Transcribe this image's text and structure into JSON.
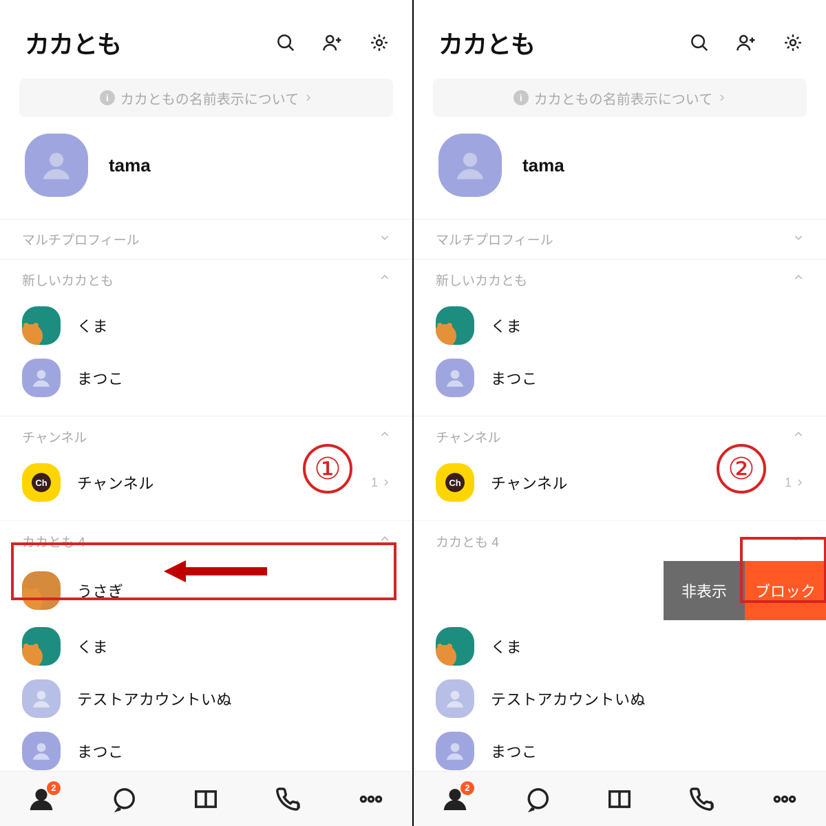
{
  "header": {
    "title": "カカとも"
  },
  "info_banner": {
    "text": "カカともの名前表示について"
  },
  "me": {
    "name": "tama"
  },
  "sections": {
    "multi_profile": "マルチプロフィール",
    "new_friends": "新しいカカとも",
    "channel": "チャンネル",
    "friends": "カカとも 4"
  },
  "new_friends": [
    {
      "name": "くま",
      "avatar": "teal_ryan"
    },
    {
      "name": "まつこ",
      "avatar": "blue_person"
    }
  ],
  "channel": {
    "name": "チャンネル",
    "count": "1"
  },
  "friends_left": [
    {
      "name": "うさぎ",
      "avatar": "orange_ryan"
    },
    {
      "name": "くま",
      "avatar": "teal_ryan"
    },
    {
      "name": "テストアカウントいぬ",
      "avatar": "pblue_person"
    },
    {
      "name": "まつこ",
      "avatar": "blue_person"
    }
  ],
  "friends_right": [
    {
      "name": "くま",
      "avatar": "teal_ryan"
    },
    {
      "name": "テストアカウントいぬ",
      "avatar": "pblue_person"
    },
    {
      "name": "まつこ",
      "avatar": "blue_person"
    }
  ],
  "swipe": {
    "hide": "非表示",
    "block": "ブロック"
  },
  "tabbar": {
    "badge": "2"
  },
  "annotation": {
    "step1": "①",
    "step2": "②"
  }
}
